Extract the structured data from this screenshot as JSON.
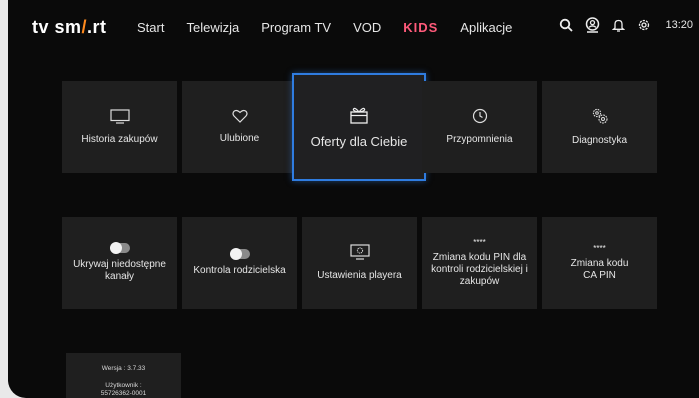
{
  "logo": {
    "left": "tv sm",
    "accent": "/",
    "right": ".rt"
  },
  "nav": [
    {
      "label": "Start",
      "color": "#e6e6e6"
    },
    {
      "label": "Telewizja",
      "color": "#e6e6e6"
    },
    {
      "label": "Program TV",
      "color": "#e6e6e6"
    },
    {
      "label": "VOD",
      "color": "#e6e6e6"
    },
    {
      "label": "KIDS",
      "color": "#ff5a7a"
    },
    {
      "label": "Aplikacje",
      "color": "#e6e6e6"
    }
  ],
  "header": {
    "time": "13:20"
  },
  "tiles_row1": [
    {
      "label": "Historia zakupów",
      "icon": "tv-icon"
    },
    {
      "label": "Ulubione",
      "icon": "heart-icon"
    },
    {
      "label": "Oferty dla Ciebie",
      "icon": "gift-icon",
      "focused": true
    },
    {
      "label": "Przypomnienia",
      "icon": "clock-icon"
    },
    {
      "label": "Diagnostyka",
      "icon": "gears-icon"
    }
  ],
  "tiles_row2": [
    {
      "label": "Ukrywaj niedostępne kanały",
      "icon": "toggle-icon"
    },
    {
      "label": "Kontrola rodzicielska",
      "icon": "toggle-icon"
    },
    {
      "label": "Ustawienia playera",
      "icon": "player-settings-icon"
    },
    {
      "label": "Zmiana kodu PIN dla kontroli rodzicielskiej i zakupów",
      "icon": "pin-dots-icon",
      "dots": "****"
    },
    {
      "label": "Zmiana kodu CA PIN",
      "icon": "pin-dots-icon",
      "dots": "****"
    }
  ],
  "version_tile": {
    "version": "Wersja : 3.7.33",
    "user_label": "Użytkownik :",
    "user_id": "55726362-0001"
  },
  "colors": {
    "focus": "#2f7ce0",
    "tile": "#1f1f1f",
    "background": "#0a0a0a",
    "logo_accent": "#ff8a1e"
  }
}
